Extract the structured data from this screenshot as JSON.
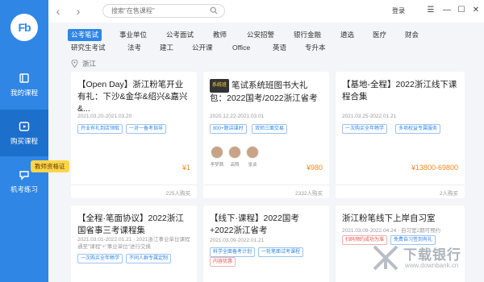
{
  "app": {
    "logo_text": "Fb"
  },
  "sidebar": {
    "items": [
      {
        "label": "我的课程",
        "icon": "book-icon"
      },
      {
        "label": "购买课程",
        "icon": "play-icon"
      },
      {
        "label": "机考练习",
        "icon": "chat-icon"
      }
    ],
    "tooltip": "教师资格证"
  },
  "topbar": {
    "search_placeholder": "搜索\"在售课程\"",
    "login_label": "登录"
  },
  "categories": [
    "公考笔试",
    "事业单位",
    "公考面试",
    "教师",
    "公安招警",
    "银行金融",
    "遴选",
    "医疗",
    "财会",
    "研究生考试",
    "法考",
    "建工",
    "公开课",
    "Office",
    "英语",
    "专升本"
  ],
  "region": "浙江",
  "cards": [
    {
      "title": "【Open Day】浙江粉笔开业有礼：下沙&金华&绍兴&嘉兴&...",
      "date": "2021.03.20-2021.03.20",
      "tags": [
        "开业有礼到店领取",
        "一对一备考指导"
      ],
      "price": "¥1",
      "buyers": "225人购买"
    },
    {
      "badge": "系统班",
      "title": "笔试系统班图书大礼包：2022国考/2022浙江省考",
      "date": "2020.12.22-2021.03.01",
      "tags": [
        "800+题讲课时",
        "双师三面交易"
      ],
      "teachers": [
        "李梦茜",
        "高照",
        "张谈"
      ],
      "price": "¥980",
      "buyers": "2332人购买"
    },
    {
      "title": "【基地-全程】2022浙江线下课程合集",
      "date": "2021.03.25-2022.01.21",
      "tags": [
        "一次购买全年畅学",
        "多项权益专属服务"
      ],
      "price": "¥13800-69800",
      "buyers": "2人购买"
    },
    {
      "title": "【全程·笔面协议】2022浙江国省事三考课程集",
      "date": "2021.03.01-2022.01.21 · 2021浙江事业单位课程通至\"课程\"+\"事业单位\"进行交换",
      "tags": [
        "一次购买全年畅学",
        "不同人群专属定制"
      ]
    },
    {
      "title": "【线下·课程】2022国考+2022浙江省考",
      "date": "2021.03.09-2022.01.21",
      "tags": [
        "科学全面备考计划",
        "一轮笔面试考课程"
      ],
      "tags_red": [
        "内容优惠"
      ]
    },
    {
      "title": "浙江粉笔线下上岸自习室",
      "date": "2021.03.09-2022.04.24 · 自习室2期可预约",
      "tags": [
        "扫码预约成功为准",
        "免费自习签到有礼"
      ]
    }
  ],
  "watermark": {
    "text": "下载银行",
    "sub": "www.downbank.cn"
  },
  "colors": {
    "primary": "#2f86e4",
    "price": "#f08a24",
    "tooltip": "#ffd54a"
  }
}
